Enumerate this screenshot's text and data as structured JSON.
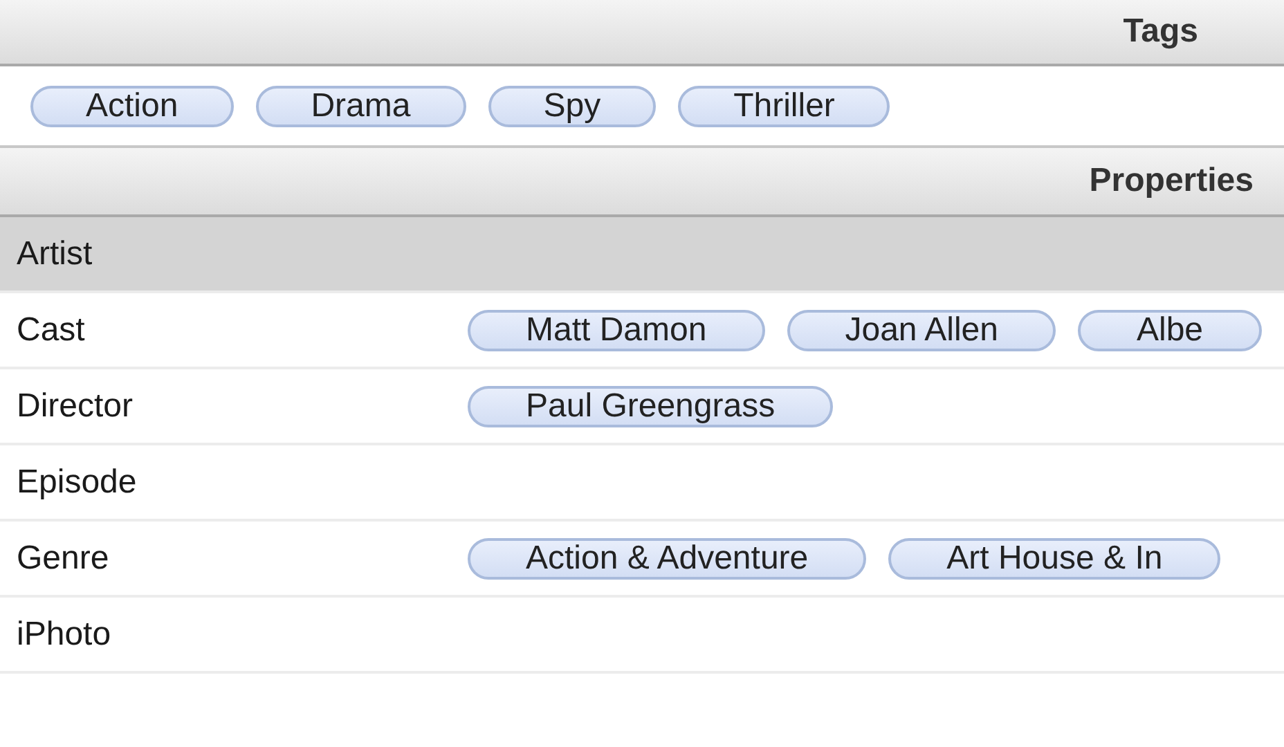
{
  "tags_section": {
    "title": "Tags",
    "tags": [
      "Action",
      "Drama",
      "Spy",
      "Thriller"
    ]
  },
  "properties_section": {
    "title": "Properties",
    "rows": [
      {
        "label": "Artist",
        "selected": true
      },
      {
        "label": "Cast",
        "selected": false,
        "values": [
          "Matt Damon",
          "Joan Allen",
          "Albe"
        ]
      },
      {
        "label": "Director",
        "selected": false,
        "values": [
          "Paul Greengrass"
        ]
      },
      {
        "label": "Episode",
        "selected": false
      },
      {
        "label": "Genre",
        "selected": false,
        "values": [
          "Action & Adventure",
          "Art House & In"
        ]
      },
      {
        "label": "iPhoto",
        "selected": false
      }
    ]
  }
}
